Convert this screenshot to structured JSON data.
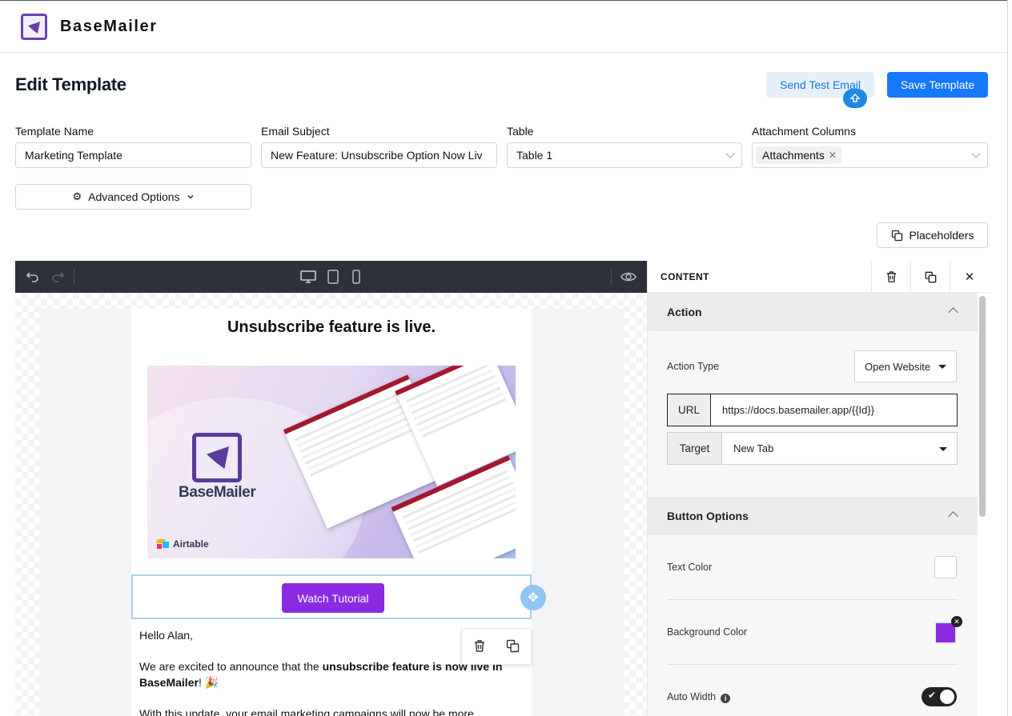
{
  "app": {
    "brand": "BaseMailer"
  },
  "page": {
    "title": "Edit Template"
  },
  "actions": {
    "send_test": "Send Test Email",
    "save": "Save Template",
    "advanced": "Advanced Options",
    "placeholders": "Placeholders"
  },
  "form": {
    "template_name": {
      "label": "Template Name",
      "value": "Marketing Template"
    },
    "email_subject": {
      "label": "Email Subject",
      "value": "New Feature: Unsubscribe Option Now Liv"
    },
    "table": {
      "label": "Table",
      "value": "Table 1"
    },
    "attachment_columns": {
      "label": "Attachment Columns",
      "chips": [
        "Attachments"
      ]
    }
  },
  "email": {
    "heading": "Unsubscribe feature is live.",
    "hero": {
      "brand": "BaseMailer",
      "partner": "Airtable"
    },
    "button_label": "Watch Tutorial",
    "greeting": "Hello Alan,",
    "para1_prefix": "We are excited to announce that the ",
    "para1_bold": "unsubscribe feature is now live in BaseMailer",
    "para1_suffix": "! 🎉",
    "para2": "With this update, your email marketing campaigns will now be more"
  },
  "panel": {
    "title": "CONTENT",
    "action_section": {
      "title": "Action",
      "action_type_label": "Action Type",
      "action_type_value": "Open Website",
      "url_label": "URL",
      "url_value": "https://docs.basemailer.app/{{Id}}",
      "target_label": "Target",
      "target_value": "New Tab"
    },
    "button_section": {
      "title": "Button Options",
      "text_color_label": "Text Color",
      "text_color": "#ffffff",
      "bg_color_label": "Background Color",
      "bg_color": "#8a2be2",
      "auto_width_label": "Auto Width",
      "auto_width": true
    }
  },
  "colors": {
    "primary": "#1677ff",
    "accent": "#8a2be2",
    "toolbar": "#2d3139"
  }
}
